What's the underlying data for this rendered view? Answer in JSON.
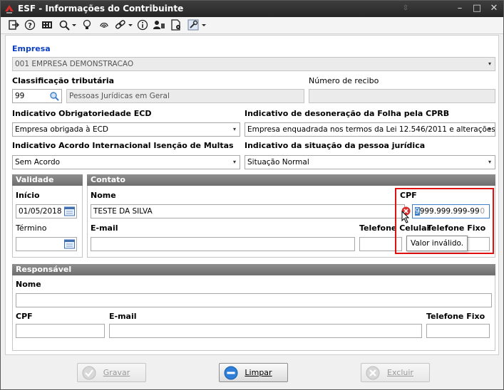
{
  "window": {
    "title": "ESF - Informações do Contribuinte",
    "minimize": "–",
    "maximize": "□",
    "close": "✕",
    "restore": "⇳"
  },
  "toolbar": {
    "icons": [
      "exit-icon",
      "help-icon",
      "calculator-icon",
      "search-icon",
      "lightbulb-icon",
      "fingerprint-icon",
      "link-icon",
      "info-icon",
      "users-icon",
      "document-settings-icon",
      "tools-icon"
    ],
    "dropdown_glyph": "▾"
  },
  "form": {
    "empresa_label": "Empresa",
    "empresa_value": "001 EMPRESA DEMONSTRACAO",
    "classificacao_label": "Classificação tributária",
    "classificacao_code": "99",
    "classificacao_desc": "Pessoas Jurídicas em Geral",
    "recibo_label": "Número de recibo",
    "recibo_value": "",
    "ecd_label": "Indicativo Obrigatoriedade ECD",
    "ecd_value": "Empresa obrigada à ECD",
    "desoneracao_label": "Indicativo de desoneração da  Folha pela CPRB",
    "desoneracao_value": "Empresa enquadrada nos termos da Lei 12.546/2011 e alterações",
    "acordo_label": "Indicativo Acordo Internacional Isenção de Multas",
    "acordo_value": "Sem Acordo",
    "situacao_label": "Indicativo da situação da pessoa jurídica",
    "situacao_value": "Situação Normal"
  },
  "validade": {
    "header": "Validade",
    "inicio_label": "Início",
    "inicio_value": "01/05/2018",
    "termino_label": "Término",
    "termino_value": ""
  },
  "contato": {
    "header": "Contato",
    "nome_label": "Nome",
    "nome_value": "TESTE DA SILVA",
    "cpf_label": "CPF",
    "cpf_value": "999.999.999-99",
    "cpf_cursor": "9",
    "cpf_counter": "0",
    "email_label": "E-mail",
    "celular_label": "Telefone Celular",
    "fixo_label": "Telefone Fixo",
    "error_tooltip": "Valor inválido."
  },
  "responsavel": {
    "header": "Responsável",
    "nome_label": "Nome",
    "cpf_label": "CPF",
    "email_label": "E-mail",
    "fixo_label": "Telefone Fixo"
  },
  "buttons": {
    "gravar": "Gravar",
    "limpar": "Limpar",
    "excluir": "Excluir"
  },
  "colors": {
    "accent_blue": "#0b3fc1",
    "error_red": "#e01010"
  }
}
